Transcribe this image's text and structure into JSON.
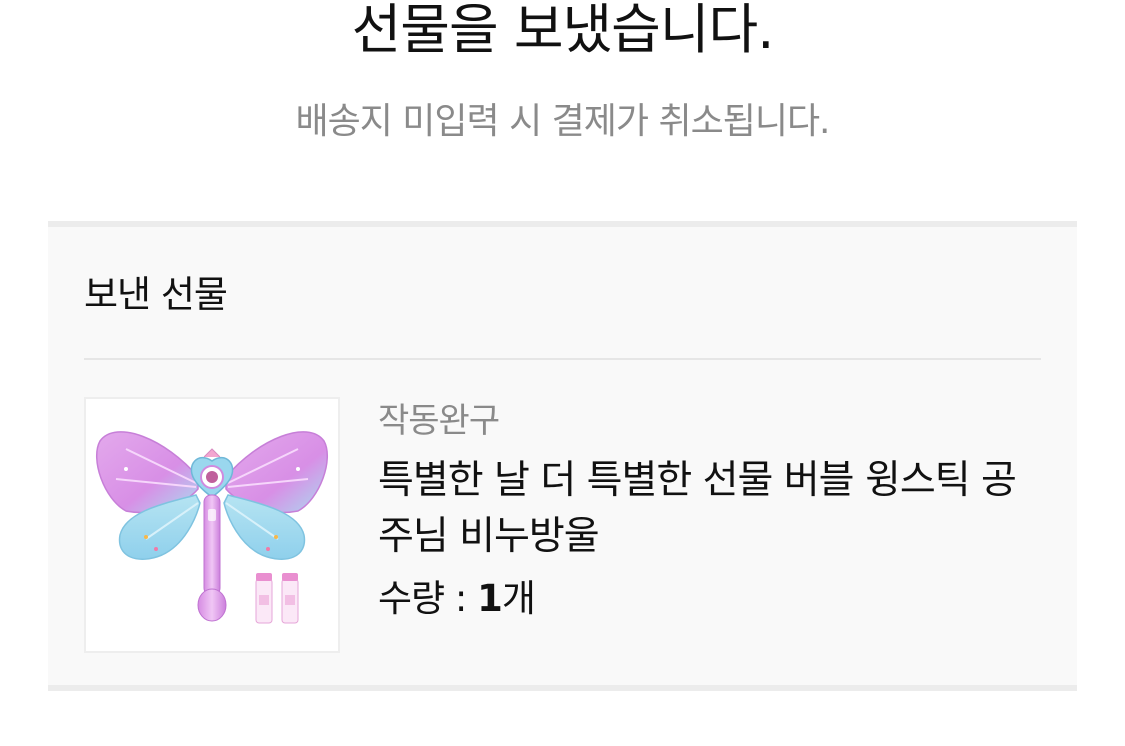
{
  "header": {
    "title": "선물을 보냈습니다.",
    "subtitle": "배송지 미입력 시 결제가 취소됩니다."
  },
  "gift_card": {
    "heading": "보낸 선물",
    "item": {
      "image_icon": "butterfly-wing-bubble-wand",
      "brand": "작동완구",
      "name": "특별한 날 더 특별한 선물 버블 윙스틱 공주님 비누방울",
      "quantity_label": "수량 : ",
      "quantity_value": "1",
      "quantity_unit": "개"
    }
  },
  "colors": {
    "title_text": "#111111",
    "muted_text": "#8a8a8a",
    "card_background": "#f9f9f9",
    "card_border": "#ececec"
  }
}
